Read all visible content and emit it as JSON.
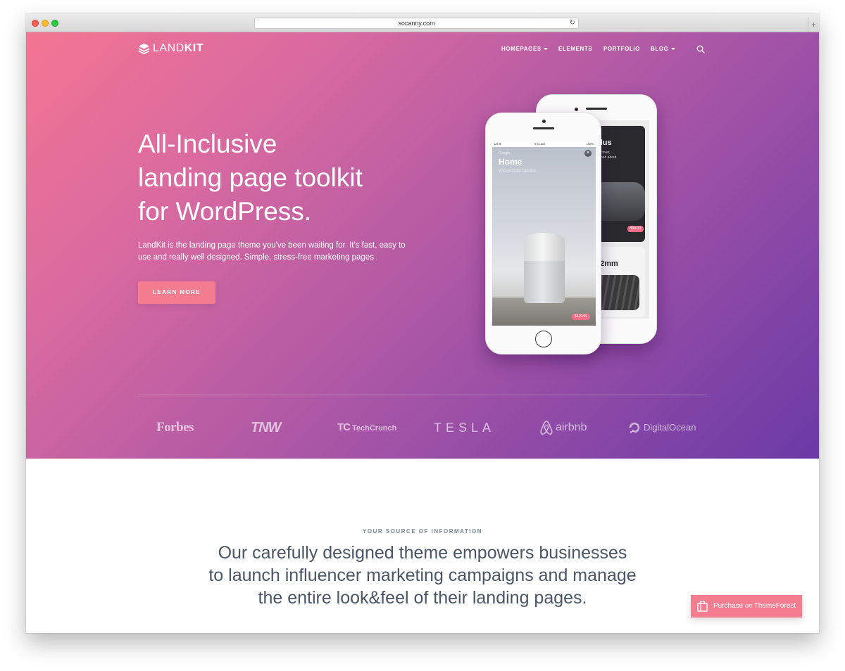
{
  "browser": {
    "url": "socanny.com",
    "reload_glyph": "↻",
    "newtab_glyph": "+"
  },
  "brand": {
    "logo_light": "LAND",
    "logo_bold": "KIT",
    "accent_color": "#f47d8f",
    "gradient_start": "#f47592",
    "gradient_end": "#6a3aa6"
  },
  "nav": {
    "items": [
      {
        "label": "HOMEPAGES",
        "has_dropdown": true
      },
      {
        "label": "ELEMENTS",
        "has_dropdown": false
      },
      {
        "label": "PORTFOLIO",
        "has_dropdown": false
      },
      {
        "label": "BLOG",
        "has_dropdown": true
      }
    ],
    "search_icon": "search-icon"
  },
  "hero": {
    "headline_line1": "All-Inclusive",
    "headline_line2": "landing page toolkit",
    "headline_line3": "for WordPress.",
    "lead": "LandKit is the landing page theme you've been waiting for. It's fast, easy to use and really well designed. Simple, stress-free marketing pages.",
    "cta_label": "LEARN MORE"
  },
  "phone_front": {
    "status_left": "UII ☰",
    "status_time": "9:41 AM",
    "status_right": "100%",
    "card_kicker": "Google",
    "card_title": "Home",
    "card_subtitle": "Voice-activated speaker.",
    "close_glyph": "✕",
    "price": "$129.99"
  },
  "phone_back": {
    "card1_title": "ulus",
    "card1_sub1": "Discover,",
    "card1_sub2": "eamed about.",
    "price": "$99.00",
    "card2_title": "42mm"
  },
  "brands": [
    "Forbes",
    "TNW",
    "TechCrunch",
    "TESLA",
    "airbnb",
    "DigitalOcean"
  ],
  "brand_marks": {
    "techcrunch_mark": "TC"
  },
  "section": {
    "kicker": "YOUR SOURCE OF INFORMATION",
    "line1": "Our carefully designed theme empowers businesses",
    "line2": "to launch influencer marketing campaigns and manage",
    "line3": "the entire look&feel of their landing pages."
  },
  "purchase": {
    "label_before": "Purchase ",
    "label_on": "on",
    "label_after": " ThemeForest"
  }
}
